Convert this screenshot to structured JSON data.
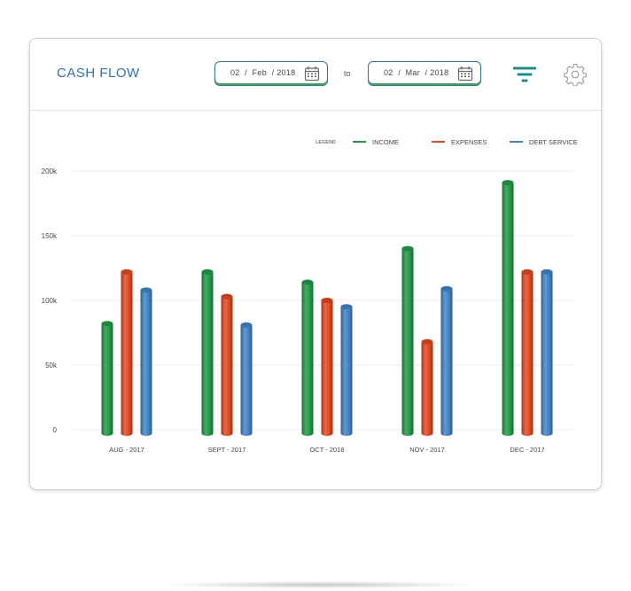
{
  "header": {
    "title": "CASH FLOW",
    "from_date": "02  /  Feb  / 2018",
    "to_label": "to",
    "to_date": "02  /  Mar  / 2018"
  },
  "colors": {
    "income": "#1f9a45",
    "expenses": "#e2471f",
    "debt_service": "#3f83c6",
    "title": "#2e72b8",
    "accent": "#1a8f8f"
  },
  "icons": {
    "calendar": "calendar-icon",
    "filter": "filter-icon",
    "settings": "gear-icon"
  },
  "chart_data": {
    "type": "bar",
    "title": "",
    "xlabel": "",
    "ylabel": "",
    "legend_title": "LEGEND",
    "legend_position": "top-right",
    "grid": true,
    "categories": [
      "AUG - 2017",
      "SEPT - 2017",
      "OCT - 2018",
      "NOV - 2017",
      "DEC - 2017"
    ],
    "series": [
      {
        "name": "INCOME",
        "key": "income",
        "values": [
          82000,
          122000,
          114000,
          140000,
          191000
        ]
      },
      {
        "name": "EXPENSES",
        "key": "expenses",
        "values": [
          122000,
          103000,
          100000,
          68000,
          122000
        ]
      },
      {
        "name": "DEBT SERVICE",
        "key": "debt_service",
        "values": [
          108000,
          81000,
          95000,
          109000,
          122000
        ]
      }
    ],
    "ylim": [
      0,
      200000
    ],
    "yticks": [
      0,
      50000,
      100000,
      150000,
      200000
    ],
    "ytick_labels": [
      "0",
      "50k",
      "100k",
      "150k",
      "200k"
    ]
  }
}
